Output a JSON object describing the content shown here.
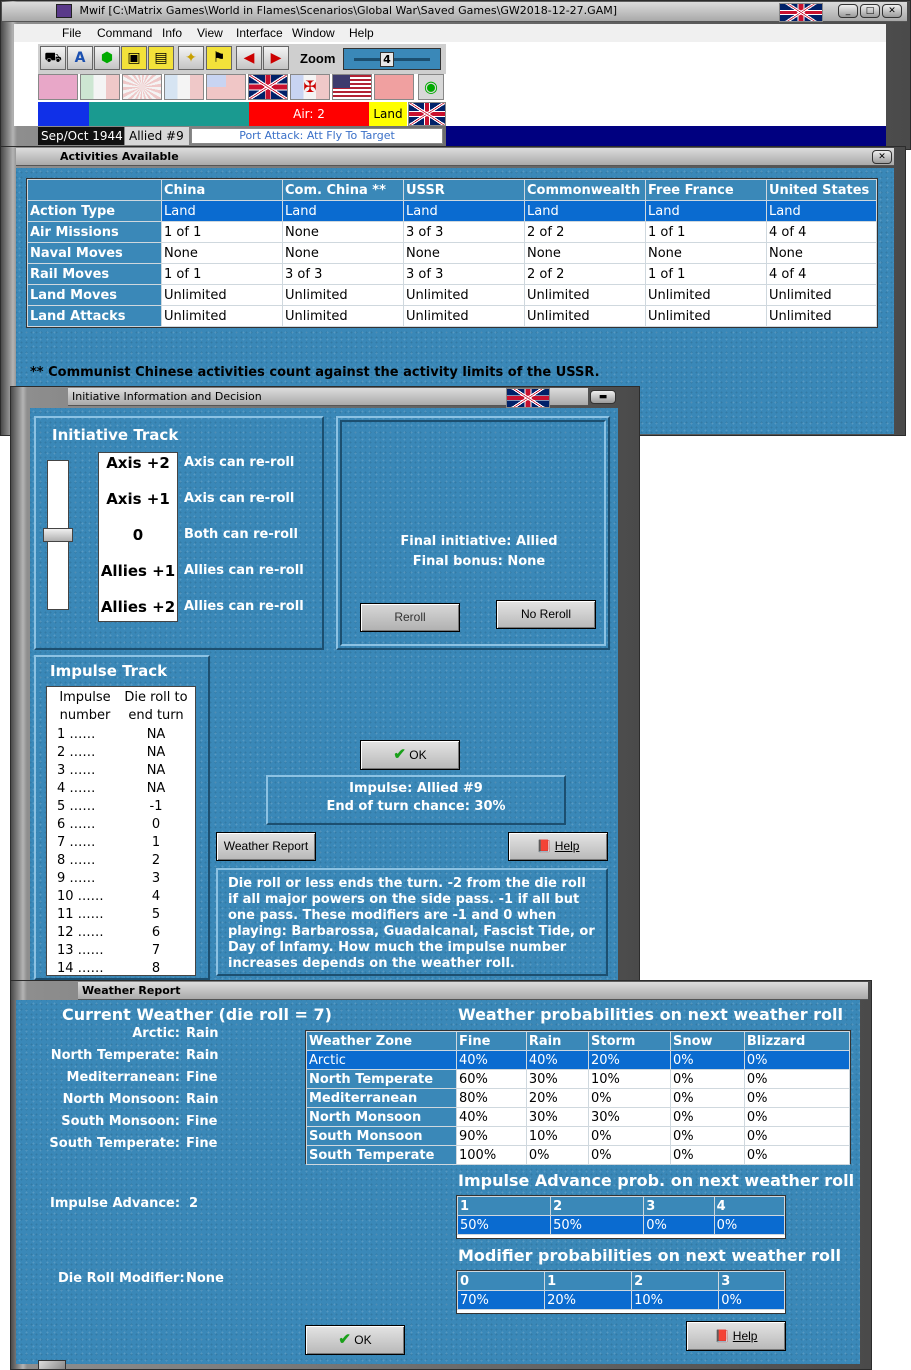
{
  "main_window": {
    "title": "Mwif [C:\\Matrix Games\\World in Flames\\Scenarios\\Global War\\Saved Games\\GW2018-12-27.GAM]",
    "menu": [
      "File",
      "Command",
      "Info",
      "View",
      "Interface",
      "Window",
      "Help"
    ],
    "zoom_label": "Zoom",
    "zoom_value": "4",
    "air_label": "Air: 2",
    "land_label": "Land",
    "date": "Sep/Oct 1944",
    "impulse": "Allied #9",
    "status_message": "Port Attack: Att Fly To Target"
  },
  "activities": {
    "title": "Activities Available",
    "columns": [
      "",
      "China",
      "Com. China **",
      "USSR",
      "Commonwealth",
      "Free France",
      "United States"
    ],
    "rows": [
      {
        "label": "Action Type",
        "values": [
          "Land",
          "Land",
          "Land",
          "Land",
          "Land",
          "Land"
        ],
        "selected": true
      },
      {
        "label": "Air Missions",
        "values": [
          "1 of 1",
          "None",
          "3 of 3",
          "2 of 2",
          "1 of 1",
          "4 of 4"
        ]
      },
      {
        "label": "Naval Moves",
        "values": [
          "None",
          "None",
          "None",
          "None",
          "None",
          "None"
        ]
      },
      {
        "label": "Rail Moves",
        "values": [
          "1 of 1",
          "3 of 3",
          "3 of 3",
          "2 of 2",
          "1 of 1",
          "4 of 4"
        ]
      },
      {
        "label": "Land Moves",
        "values": [
          "Unlimited",
          "Unlimited",
          "Unlimited",
          "Unlimited",
          "Unlimited",
          "Unlimited"
        ]
      },
      {
        "label": "Land Attacks",
        "values": [
          "Unlimited",
          "Unlimited",
          "Unlimited",
          "Unlimited",
          "Unlimited",
          "Unlimited"
        ]
      }
    ],
    "footnote": "** Communist Chinese activities count against the activity limits of the USSR."
  },
  "initiative": {
    "title": "Initiative Information and Decision",
    "track_title": "Initiative Track",
    "track": [
      {
        "level": "Axis +2",
        "desc": "Axis can re-roll"
      },
      {
        "level": "Axis +1",
        "desc": "Axis can re-roll"
      },
      {
        "level": "0",
        "desc": "Both can re-roll"
      },
      {
        "level": "Allies +1",
        "desc": "Allies can re-roll"
      },
      {
        "level": "Allies +2",
        "desc": "Allies can re-roll"
      }
    ],
    "final_initiative": "Final initiative: Allied",
    "final_bonus": "Final bonus: None",
    "reroll_label": "Reroll",
    "noreroll_label": "No Reroll",
    "impulse_track_title": "Impulse Track",
    "impulse_col1": "Impulse number",
    "impulse_col2": "Die roll to end turn",
    "impulse_rows": [
      [
        "1 ……",
        "NA"
      ],
      [
        "2 ……",
        "NA"
      ],
      [
        "3 ……",
        "NA"
      ],
      [
        "4 ……",
        "NA"
      ],
      [
        "5 ……",
        "-1"
      ],
      [
        "6 ……",
        "0"
      ],
      [
        "7 ……",
        "1"
      ],
      [
        "8 ……",
        "2"
      ],
      [
        "9 ……",
        "3"
      ],
      [
        "10 ……",
        "4"
      ],
      [
        "11 ……",
        "5"
      ],
      [
        "12 ……",
        "6"
      ],
      [
        "13 ……",
        "7"
      ],
      [
        "14 ……",
        "8"
      ]
    ],
    "ok_label": "OK",
    "impulse_line": "Impulse: Allied #9",
    "end_chance": "End of turn chance: 30%",
    "weather_report_label": "Weather Report",
    "help_label": "Help",
    "description": "Die roll or less ends the turn.  -2 from the die roll if all major powers on the side pass.  -1 if all but one pass.  These modifiers are -1 and 0 when playing: Barbarossa, Guadalcanal, Fascist Tide, or Day of Infamy.  How much the impulse number increases depends on the weather roll."
  },
  "weather": {
    "title": "Weather Report",
    "current_title": "Current Weather (die roll = 7)",
    "current": [
      {
        "zone": "Arctic:",
        "value": "Rain"
      },
      {
        "zone": "North Temperate:",
        "value": "Rain"
      },
      {
        "zone": "Mediterranean:",
        "value": "Fine"
      },
      {
        "zone": "North Monsoon:",
        "value": "Rain"
      },
      {
        "zone": "South Monsoon:",
        "value": "Fine"
      },
      {
        "zone": "South Temperate:",
        "value": "Fine"
      }
    ],
    "prob_title": "Weather probabilities on next weather roll",
    "prob_columns": [
      "Weather Zone",
      "Fine",
      "Rain",
      "Storm",
      "Snow",
      "Blizzard"
    ],
    "prob_rows": [
      [
        "Arctic",
        "40%",
        "40%",
        "20%",
        "0%",
        "0%"
      ],
      [
        "North Temperate",
        "60%",
        "30%",
        "10%",
        "0%",
        "0%"
      ],
      [
        "Mediterranean",
        "80%",
        "20%",
        "0%",
        "0%",
        "0%"
      ],
      [
        "North Monsoon",
        "40%",
        "30%",
        "30%",
        "0%",
        "0%"
      ],
      [
        "South Monsoon",
        "90%",
        "10%",
        "0%",
        "0%",
        "0%"
      ],
      [
        "South Temperate",
        "100%",
        "0%",
        "0%",
        "0%",
        "0%"
      ]
    ],
    "impulse_advance_label": "Impulse Advance:",
    "impulse_advance_value": "2",
    "advance_title": "Impulse Advance prob. on next weather roll",
    "advance_columns": [
      "1",
      "2",
      "3",
      "4"
    ],
    "advance_values": [
      "50%",
      "50%",
      "0%",
      "0%"
    ],
    "modifier_label": "Die Roll Modifier:",
    "modifier_value": "None",
    "modifier_title": "Modifier probabilities on next weather roll",
    "modifier_columns": [
      "0",
      "1",
      "2",
      "3"
    ],
    "modifier_values": [
      "70%",
      "20%",
      "10%",
      "0%"
    ],
    "ok_label": "OK",
    "help_label": "Help"
  }
}
